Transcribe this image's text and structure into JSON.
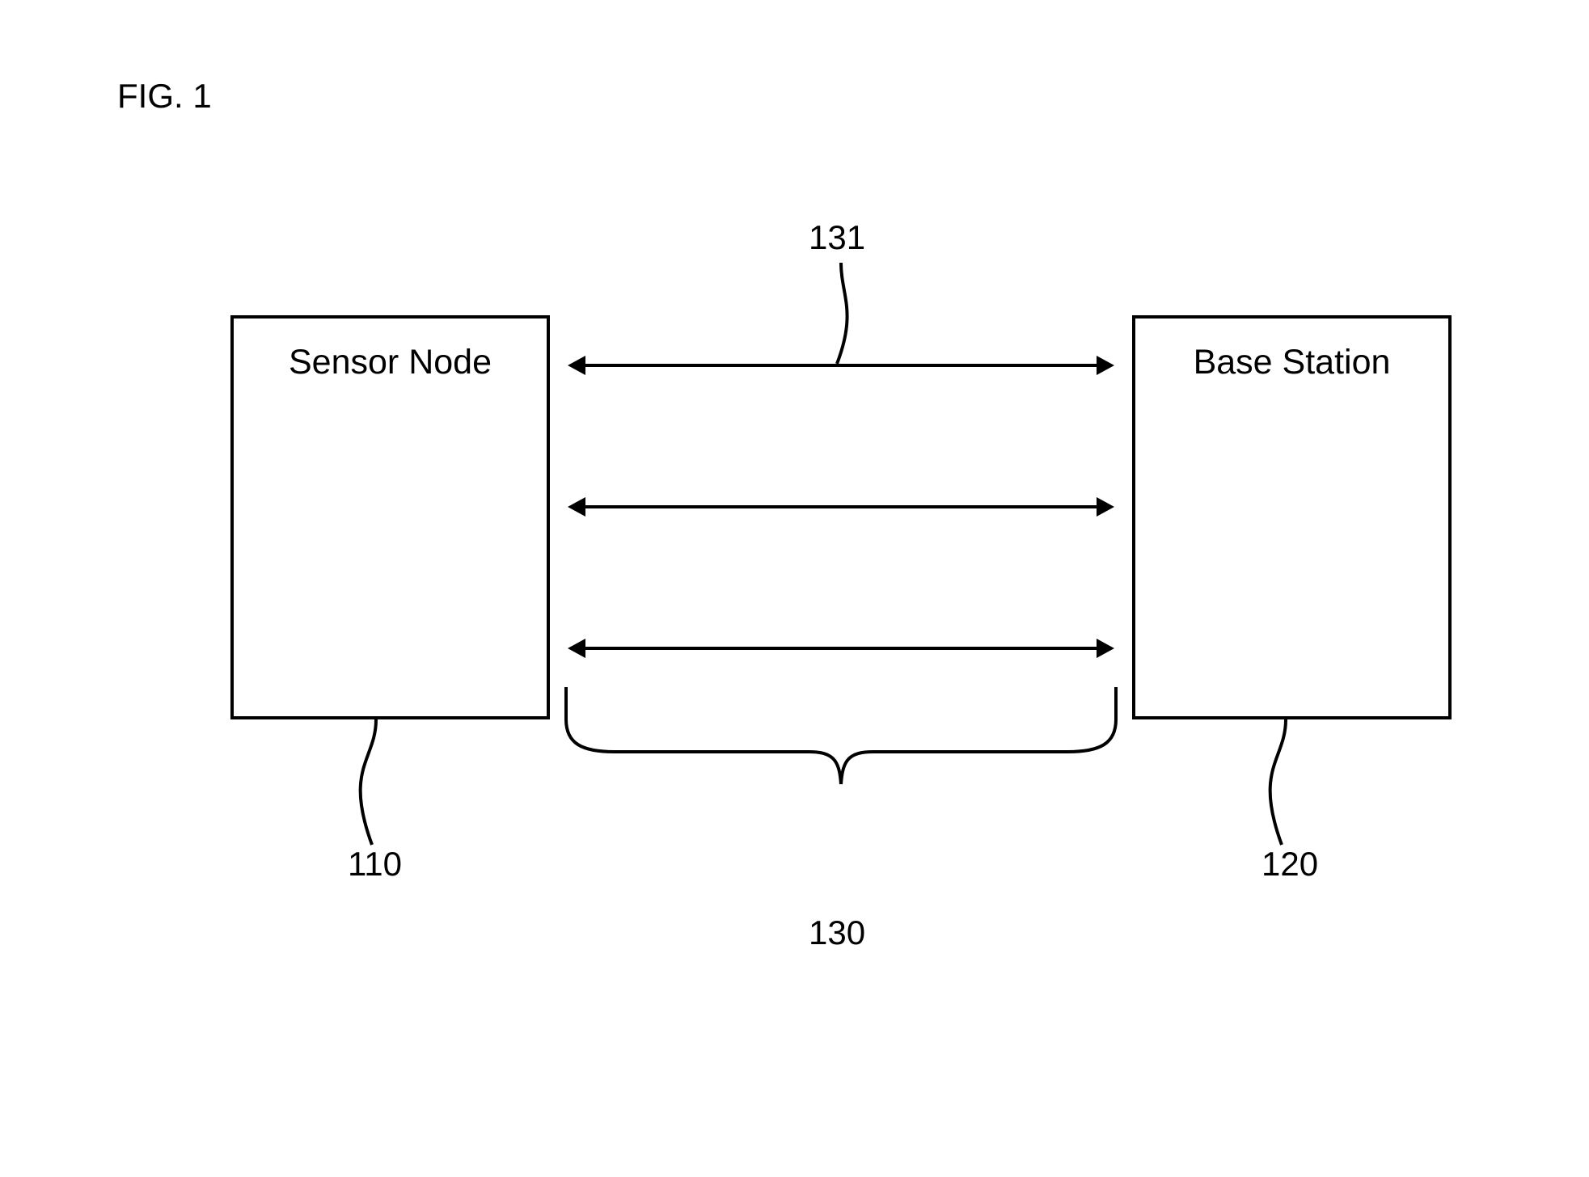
{
  "figure_caption": "FIG. 1",
  "boxes": {
    "sensor_node": {
      "label": "Sensor Node",
      "ref": "110"
    },
    "base_station": {
      "label": "Base Station",
      "ref": "120"
    }
  },
  "links": {
    "group_ref": "130",
    "single_ref": "131"
  }
}
